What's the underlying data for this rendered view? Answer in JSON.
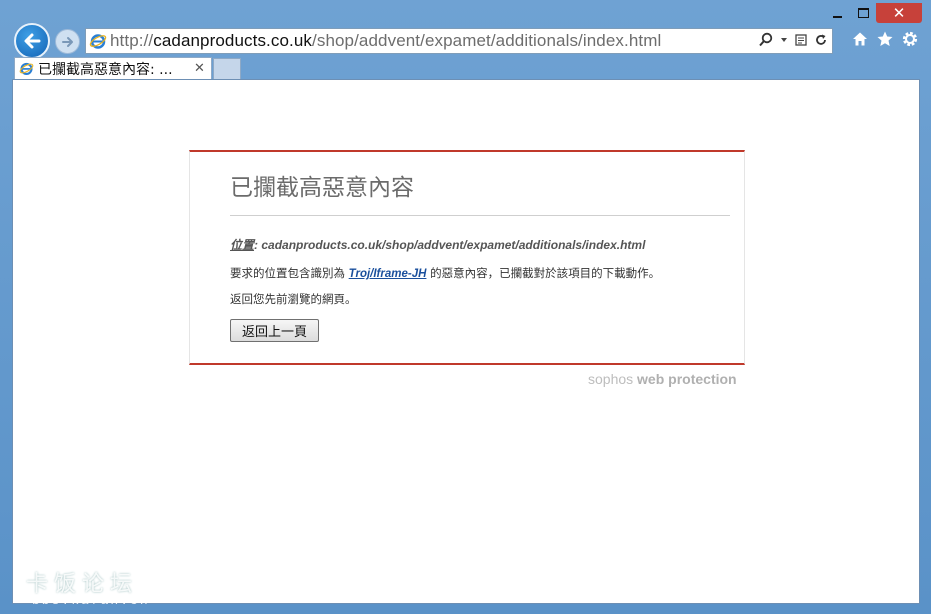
{
  "window": {
    "minimize_icon": "minimize-icon",
    "maximize_icon": "maximize-icon",
    "close_glyph": "✕"
  },
  "nav": {
    "back_icon": "back-arrow-icon",
    "forward_icon": "forward-arrow-icon"
  },
  "address": {
    "scheme": "http://",
    "host": "cadanproducts.co.uk",
    "path": "/shop/addvent/expamet/additionals/index.html"
  },
  "tab": {
    "title": "已攔截高惡意內容: ...",
    "close_glyph": "✕"
  },
  "block_page": {
    "title": "已攔截高惡意內容",
    "location_label": "位置",
    "location_sep": ": ",
    "location_url": "cadanproducts.co.uk/shop/addvent/expamet/additionals/index.html",
    "message_prefix": "要求的位置包含識別為 ",
    "threat_name": "Troj/Iframe-JH",
    "message_suffix": " 的惡意內容，已攔截對於該項目的下載動作。",
    "back_hint": "返回您先前瀏覽的網頁。",
    "back_button": "返回上一頁",
    "brand_light": "sophos",
    "brand_bold": "web protection"
  },
  "watermark": {
    "line1": "卡饭论坛",
    "line2": "bbs.kafan.cn"
  },
  "colors": {
    "accent_red": "#c0392b",
    "link_blue": "#1a4f9c",
    "chrome_blue": "#5a92c8"
  }
}
